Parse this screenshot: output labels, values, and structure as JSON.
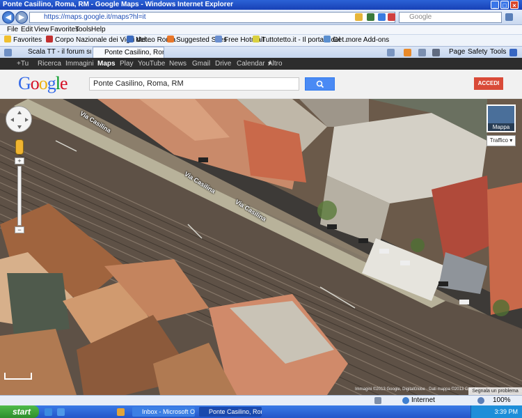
{
  "window": {
    "title": "Ponte Casilino, Roma, RM - Google Maps - Windows Internet Explorer"
  },
  "address": {
    "url": "https://maps.google.it/maps?hl=it",
    "search_placeholder": "Google"
  },
  "menu": [
    "File",
    "Edit",
    "View",
    "Favorites",
    "Tools",
    "Help"
  ],
  "favorites": {
    "label": "Favorites",
    "items": [
      "Corpo Nazionale dei Vigili del...",
      "Meteo Roma",
      "Suggested Sites",
      "Free Hotmail",
      "Tuttotetto.it - Il portale del ...",
      "Get more Add-ons"
    ]
  },
  "tabs": [
    "Scala TT - il forum sulla \"scala\"...",
    "Ponte Casilino, Roma, RM..."
  ],
  "ie_tools": {
    "page": "Page",
    "safety": "Safety",
    "tools": "Tools"
  },
  "google_bar": [
    "+Tu",
    "Ricerca",
    "Immagini",
    "Maps",
    "Play",
    "YouTube",
    "News",
    "Gmail",
    "Drive",
    "Calendar",
    "Altro"
  ],
  "google": {
    "logo": "Google",
    "search_value": "Ponte Casilino, Roma, RM",
    "signin": "ACCEDI"
  },
  "map": {
    "type_label": "Mappa",
    "traffic_label": "Traffico",
    "road_labels": [
      "Via Casilina",
      "Via Casilina",
      "Via Casilina"
    ],
    "report": "Segnala un problema",
    "copyright": "Immagini ©2013 Google, DigitalGlobe · Dati mappa ©2013 Google",
    "zoom_in": "+",
    "zoom_out": "−"
  },
  "status": {
    "zone": "Internet",
    "zoom": "100%"
  },
  "taskbar": {
    "start": "start",
    "tasks": [
      "Inbox - Microsoft Out...",
      "Ponte Casilino, Roma,..."
    ],
    "clock": "3:39 PM"
  }
}
